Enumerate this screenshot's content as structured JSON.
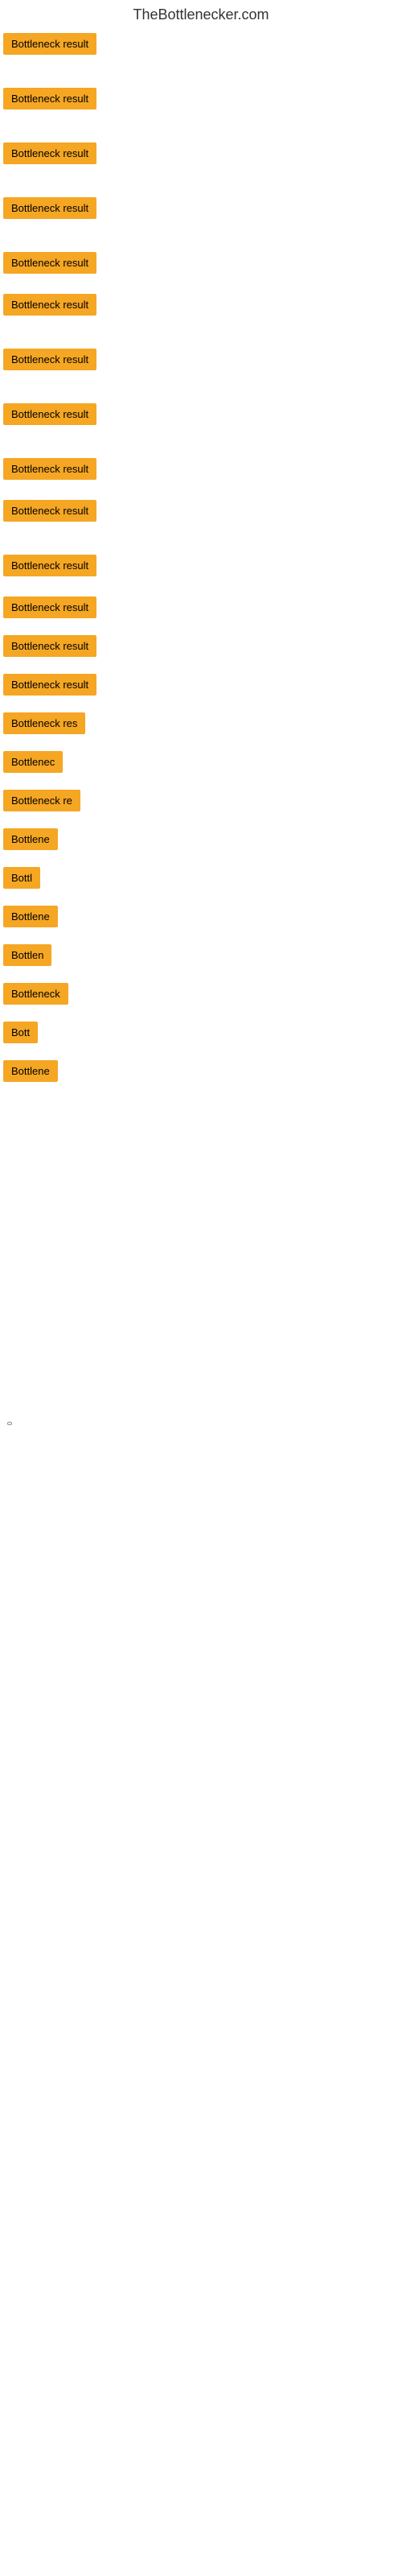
{
  "site": {
    "title": "TheBottlenecker.com"
  },
  "items": [
    {
      "id": 1,
      "label": "Bottleneck result",
      "width_class": "item-full",
      "spacer": "none"
    },
    {
      "id": 2,
      "label": "Bottleneck result",
      "width_class": "item-full",
      "spacer": "medium"
    },
    {
      "id": 3,
      "label": "Bottleneck result",
      "width_class": "item-full",
      "spacer": "medium"
    },
    {
      "id": 4,
      "label": "Bottleneck result",
      "width_class": "item-full",
      "spacer": "medium"
    },
    {
      "id": 5,
      "label": "Bottleneck result",
      "width_class": "item-full",
      "spacer": "medium"
    },
    {
      "id": 6,
      "label": "Bottleneck result",
      "width_class": "item-full",
      "spacer": "none"
    },
    {
      "id": 7,
      "label": "Bottleneck result",
      "width_class": "item-full",
      "spacer": "medium"
    },
    {
      "id": 8,
      "label": "Bottleneck result",
      "width_class": "item-full",
      "spacer": "medium"
    },
    {
      "id": 9,
      "label": "Bottleneck result",
      "width_class": "item-full",
      "spacer": "medium"
    },
    {
      "id": 10,
      "label": "Bottleneck result",
      "width_class": "item-full",
      "spacer": "none"
    },
    {
      "id": 11,
      "label": "Bottleneck result",
      "width_class": "item-full",
      "spacer": "medium"
    },
    {
      "id": 12,
      "label": "Bottleneck result",
      "width_class": "item-full",
      "spacer": "none"
    },
    {
      "id": 13,
      "label": "Bottleneck result",
      "width_class": "item-full",
      "spacer": "none"
    },
    {
      "id": 14,
      "label": "Bottleneck result",
      "width_class": "item-full",
      "spacer": "none"
    },
    {
      "id": 15,
      "label": "Bottleneck res",
      "width_class": "item-w140",
      "spacer": "none"
    },
    {
      "id": 16,
      "label": "Bottlenec",
      "width_class": "item-w90",
      "spacer": "none"
    },
    {
      "id": 17,
      "label": "Bottleneck re",
      "width_class": "item-w120",
      "spacer": "none"
    },
    {
      "id": 18,
      "label": "Bottlene",
      "width_class": "item-w80",
      "spacer": "none"
    },
    {
      "id": 19,
      "label": "Bottl",
      "width_class": "item-w60",
      "spacer": "none"
    },
    {
      "id": 20,
      "label": "Bottlene",
      "width_class": "item-w80",
      "spacer": "none"
    },
    {
      "id": 21,
      "label": "Bottlen",
      "width_class": "item-w70",
      "spacer": "none"
    },
    {
      "id": 22,
      "label": "Bottleneck",
      "width_class": "item-w100",
      "spacer": "none"
    },
    {
      "id": 23,
      "label": "Bott",
      "width_class": "item-w50",
      "spacer": "none"
    },
    {
      "id": 24,
      "label": "Bottlene",
      "width_class": "item-w80",
      "spacer": "none"
    }
  ],
  "bottom_label": "0"
}
